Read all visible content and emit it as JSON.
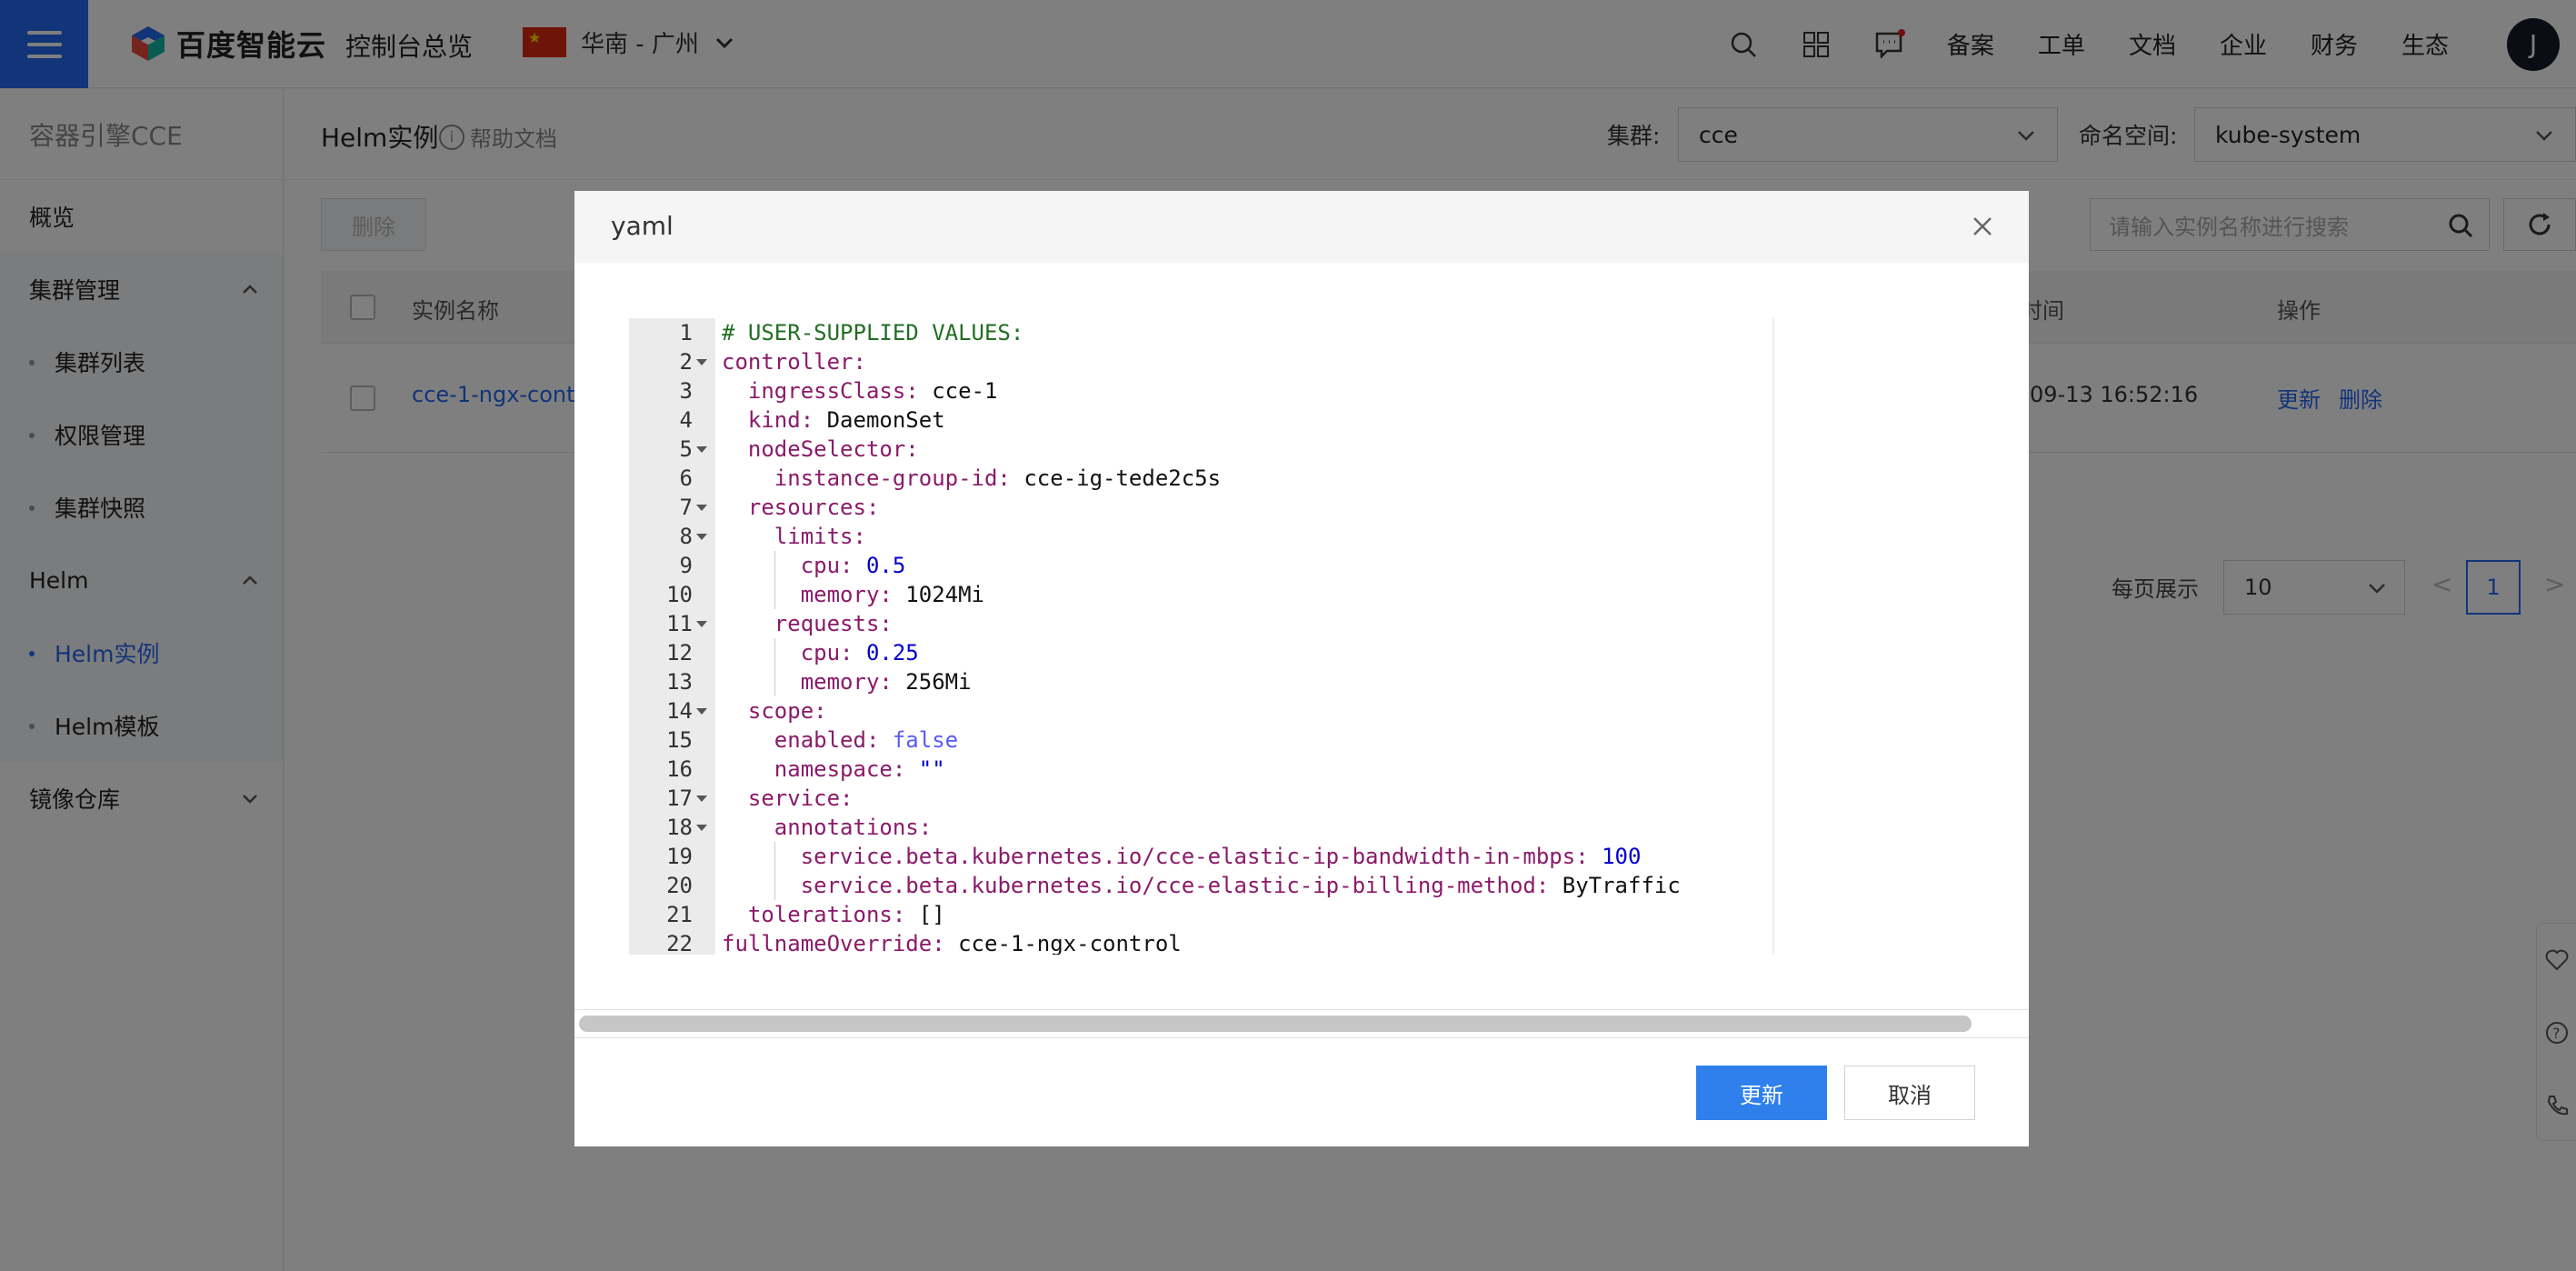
{
  "topbar": {
    "logo_text": "百度智能云",
    "overview": "控制台总览",
    "region": "华南 - 广州",
    "nav": [
      "备案",
      "工单",
      "文档",
      "企业",
      "财务",
      "生态"
    ],
    "avatar_letter": "J"
  },
  "sidebar": {
    "title": "容器引擎CCE",
    "items": {
      "overview": "概览",
      "cluster_group": "集群管理",
      "cluster_list": "集群列表",
      "permission": "权限管理",
      "snapshot": "集群快照",
      "helm_group": "Helm",
      "helm_instance": "Helm实例",
      "helm_template": "Helm模板",
      "registry": "镜像仓库"
    }
  },
  "page": {
    "title": "Helm实例",
    "help": "帮助文档",
    "cluster_label": "集群:",
    "cluster_value": "cce",
    "namespace_label": "命名空间:",
    "namespace_value": "kube-system",
    "delete_button": "删除",
    "search_placeholder": "请输入实例名称进行搜索",
    "columns": {
      "name": "实例名称",
      "time": "时间",
      "actions": "操作"
    },
    "row": {
      "name": "cce-1-ngx-cont",
      "time": "09-13 16:52:16",
      "update": "更新",
      "delete": "删除"
    },
    "pager": {
      "per_page_label": "每页展示",
      "per_page": "10",
      "prev": "<",
      "current": "1",
      "next": ">"
    }
  },
  "modal": {
    "title": "yaml",
    "confirm": "更新",
    "cancel": "取消",
    "lines": [
      {
        "n": "1",
        "indent": "",
        "key": "",
        "val": "# USER-SUPPLIED VALUES:",
        "type": "comment",
        "fold": false
      },
      {
        "n": "2",
        "indent": "",
        "key": "controller:",
        "val": "",
        "type": "str",
        "fold": true
      },
      {
        "n": "3",
        "indent": "  ",
        "key": "ingressClass:",
        "val": " cce-1",
        "type": "str",
        "fold": false
      },
      {
        "n": "4",
        "indent": "  ",
        "key": "kind:",
        "val": " DaemonSet",
        "type": "str",
        "fold": false
      },
      {
        "n": "5",
        "indent": "  ",
        "key": "nodeSelector:",
        "val": "",
        "type": "str",
        "fold": true
      },
      {
        "n": "6",
        "indent": "    ",
        "key": "instance-group-id:",
        "val": " cce-ig-tede2c5s",
        "type": "str",
        "fold": false
      },
      {
        "n": "7",
        "indent": "  ",
        "key": "resources:",
        "val": "",
        "type": "str",
        "fold": true
      },
      {
        "n": "8",
        "indent": "    ",
        "key": "limits:",
        "val": "",
        "type": "str",
        "fold": true
      },
      {
        "n": "9",
        "indent": "      ",
        "key": "cpu:",
        "val": " 0.5",
        "type": "num",
        "fold": false
      },
      {
        "n": "10",
        "indent": "      ",
        "key": "memory:",
        "val": " 1024Mi",
        "type": "str",
        "fold": false
      },
      {
        "n": "11",
        "indent": "    ",
        "key": "requests:",
        "val": "",
        "type": "str",
        "fold": true
      },
      {
        "n": "12",
        "indent": "      ",
        "key": "cpu:",
        "val": " 0.25",
        "type": "num",
        "fold": false
      },
      {
        "n": "13",
        "indent": "      ",
        "key": "memory:",
        "val": " 256Mi",
        "type": "str",
        "fold": false
      },
      {
        "n": "14",
        "indent": "  ",
        "key": "scope:",
        "val": "",
        "type": "str",
        "fold": true
      },
      {
        "n": "15",
        "indent": "    ",
        "key": "enabled:",
        "val": " false",
        "type": "bool",
        "fold": false
      },
      {
        "n": "16",
        "indent": "    ",
        "key": "namespace:",
        "val": " \"\"",
        "type": "num",
        "fold": false
      },
      {
        "n": "17",
        "indent": "  ",
        "key": "service:",
        "val": "",
        "type": "str",
        "fold": true
      },
      {
        "n": "18",
        "indent": "    ",
        "key": "annotations:",
        "val": "",
        "type": "str",
        "fold": true
      },
      {
        "n": "19",
        "indent": "      ",
        "key": "service.beta.kubernetes.io/cce-elastic-ip-bandwidth-in-mbps:",
        "val": " 100",
        "type": "num",
        "fold": false
      },
      {
        "n": "20",
        "indent": "      ",
        "key": "service.beta.kubernetes.io/cce-elastic-ip-billing-method:",
        "val": " ByTraffic",
        "type": "str",
        "fold": false
      },
      {
        "n": "21",
        "indent": "  ",
        "key": "tolerations:",
        "val": " []",
        "type": "str",
        "fold": false
      },
      {
        "n": "22",
        "indent": "",
        "key": "fullnameOverride:",
        "val": " cce-1-ngx-control",
        "type": "str",
        "fold": false
      }
    ]
  },
  "colors": {
    "primary": "#2468f2",
    "button": "#2f80ed",
    "yaml_key": "#8b1a6a",
    "yaml_number": "#0000cd",
    "yaml_comment": "#236e24"
  }
}
